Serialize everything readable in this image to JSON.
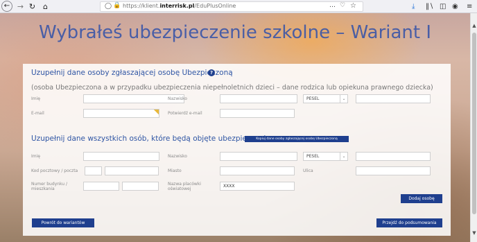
{
  "browser": {
    "url_prefix": "https://klient.",
    "url_host": "interrisk.pl",
    "url_path": "/EduPlusOnline",
    "more_icon": "…",
    "icons": {
      "back": "back-arrow-icon",
      "forward": "forward-arrow-icon",
      "reload": "reload-icon",
      "home": "home-icon",
      "shield": "tracking-shield-icon",
      "lock": "lock-icon",
      "pocket": "pocket-icon",
      "star": "bookmark-star-icon",
      "download": "download-icon",
      "library": "library-icon",
      "sidebar": "sidebar-icon",
      "account": "account-icon",
      "menu": "hamburger-menu-icon"
    }
  },
  "page": {
    "main_heading": "Wybrałeś ubezpieczenie szkolne – Wariant I"
  },
  "reporter_section": {
    "title": "Uzupełnij dane osoby zgłaszającej osobę Ubezpieczoną",
    "help": "?",
    "note": "(osoba Ubezpieczona a w przypadku ubezpieczenia niepełnoletnich dzieci – dane rodzica lub opiekuna prawnego dziecka)",
    "first_name_label": "Imię",
    "first_name_value": "",
    "last_name_label": "Nazwisko",
    "last_name_value": "",
    "id_type_selected": "PESEL",
    "id_number_value": "",
    "email_label": "E-mail",
    "email_value": "",
    "email_confirm_label": "Potwierdź e-mail",
    "email_confirm_value": ""
  },
  "insured_section": {
    "title": "Uzupełnij dane wszystkich osób, które będą objęte ubezpieczeniem",
    "copy_button": "Kopiuj dane osoby zgłaszającej osobę Ubezpieczoną",
    "first_name_label": "Imię",
    "last_name_label": "Nazwisko",
    "id_type_selected": "PESEL",
    "postal_label": "Kod pocztowy / poczta",
    "city_label": "Miasto",
    "street_label": "Ulica",
    "building_label_line1": "Numer budynku /",
    "building_label_line2": "mieszkania",
    "school_label_line1": "Nazwa placówki",
    "school_label_line2": "oświatowej",
    "school_value": "XXXX",
    "add_person_button": "Dodaj osobę"
  },
  "footer": {
    "back_button": "Powrót do wariantów",
    "summary_button": "Przejdź do podsumowania"
  },
  "colors": {
    "accent": "#1f3f8e",
    "title_blue": "#2f55a4",
    "warning_corner": "#e8b83a"
  }
}
